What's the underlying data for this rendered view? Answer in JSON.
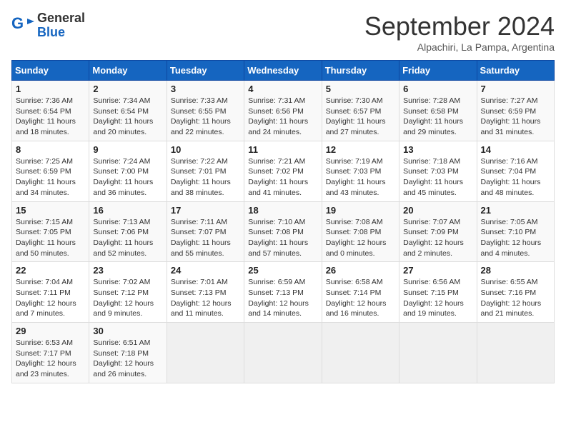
{
  "logo": {
    "line1": "General",
    "line2": "Blue"
  },
  "title": "September 2024",
  "subtitle": "Alpachiri, La Pampa, Argentina",
  "days_of_week": [
    "Sunday",
    "Monday",
    "Tuesday",
    "Wednesday",
    "Thursday",
    "Friday",
    "Saturday"
  ],
  "weeks": [
    [
      {
        "day": "1",
        "sunrise": "Sunrise: 7:36 AM",
        "sunset": "Sunset: 6:54 PM",
        "daylight": "Daylight: 11 hours and 18 minutes."
      },
      {
        "day": "2",
        "sunrise": "Sunrise: 7:34 AM",
        "sunset": "Sunset: 6:54 PM",
        "daylight": "Daylight: 11 hours and 20 minutes."
      },
      {
        "day": "3",
        "sunrise": "Sunrise: 7:33 AM",
        "sunset": "Sunset: 6:55 PM",
        "daylight": "Daylight: 11 hours and 22 minutes."
      },
      {
        "day": "4",
        "sunrise": "Sunrise: 7:31 AM",
        "sunset": "Sunset: 6:56 PM",
        "daylight": "Daylight: 11 hours and 24 minutes."
      },
      {
        "day": "5",
        "sunrise": "Sunrise: 7:30 AM",
        "sunset": "Sunset: 6:57 PM",
        "daylight": "Daylight: 11 hours and 27 minutes."
      },
      {
        "day": "6",
        "sunrise": "Sunrise: 7:28 AM",
        "sunset": "Sunset: 6:58 PM",
        "daylight": "Daylight: 11 hours and 29 minutes."
      },
      {
        "day": "7",
        "sunrise": "Sunrise: 7:27 AM",
        "sunset": "Sunset: 6:59 PM",
        "daylight": "Daylight: 11 hours and 31 minutes."
      }
    ],
    [
      {
        "day": "8",
        "sunrise": "Sunrise: 7:25 AM",
        "sunset": "Sunset: 6:59 PM",
        "daylight": "Daylight: 11 hours and 34 minutes."
      },
      {
        "day": "9",
        "sunrise": "Sunrise: 7:24 AM",
        "sunset": "Sunset: 7:00 PM",
        "daylight": "Daylight: 11 hours and 36 minutes."
      },
      {
        "day": "10",
        "sunrise": "Sunrise: 7:22 AM",
        "sunset": "Sunset: 7:01 PM",
        "daylight": "Daylight: 11 hours and 38 minutes."
      },
      {
        "day": "11",
        "sunrise": "Sunrise: 7:21 AM",
        "sunset": "Sunset: 7:02 PM",
        "daylight": "Daylight: 11 hours and 41 minutes."
      },
      {
        "day": "12",
        "sunrise": "Sunrise: 7:19 AM",
        "sunset": "Sunset: 7:03 PM",
        "daylight": "Daylight: 11 hours and 43 minutes."
      },
      {
        "day": "13",
        "sunrise": "Sunrise: 7:18 AM",
        "sunset": "Sunset: 7:03 PM",
        "daylight": "Daylight: 11 hours and 45 minutes."
      },
      {
        "day": "14",
        "sunrise": "Sunrise: 7:16 AM",
        "sunset": "Sunset: 7:04 PM",
        "daylight": "Daylight: 11 hours and 48 minutes."
      }
    ],
    [
      {
        "day": "15",
        "sunrise": "Sunrise: 7:15 AM",
        "sunset": "Sunset: 7:05 PM",
        "daylight": "Daylight: 11 hours and 50 minutes."
      },
      {
        "day": "16",
        "sunrise": "Sunrise: 7:13 AM",
        "sunset": "Sunset: 7:06 PM",
        "daylight": "Daylight: 11 hours and 52 minutes."
      },
      {
        "day": "17",
        "sunrise": "Sunrise: 7:11 AM",
        "sunset": "Sunset: 7:07 PM",
        "daylight": "Daylight: 11 hours and 55 minutes."
      },
      {
        "day": "18",
        "sunrise": "Sunrise: 7:10 AM",
        "sunset": "Sunset: 7:08 PM",
        "daylight": "Daylight: 11 hours and 57 minutes."
      },
      {
        "day": "19",
        "sunrise": "Sunrise: 7:08 AM",
        "sunset": "Sunset: 7:08 PM",
        "daylight": "Daylight: 12 hours and 0 minutes."
      },
      {
        "day": "20",
        "sunrise": "Sunrise: 7:07 AM",
        "sunset": "Sunset: 7:09 PM",
        "daylight": "Daylight: 12 hours and 2 minutes."
      },
      {
        "day": "21",
        "sunrise": "Sunrise: 7:05 AM",
        "sunset": "Sunset: 7:10 PM",
        "daylight": "Daylight: 12 hours and 4 minutes."
      }
    ],
    [
      {
        "day": "22",
        "sunrise": "Sunrise: 7:04 AM",
        "sunset": "Sunset: 7:11 PM",
        "daylight": "Daylight: 12 hours and 7 minutes."
      },
      {
        "day": "23",
        "sunrise": "Sunrise: 7:02 AM",
        "sunset": "Sunset: 7:12 PM",
        "daylight": "Daylight: 12 hours and 9 minutes."
      },
      {
        "day": "24",
        "sunrise": "Sunrise: 7:01 AM",
        "sunset": "Sunset: 7:13 PM",
        "daylight": "Daylight: 12 hours and 11 minutes."
      },
      {
        "day": "25",
        "sunrise": "Sunrise: 6:59 AM",
        "sunset": "Sunset: 7:13 PM",
        "daylight": "Daylight: 12 hours and 14 minutes."
      },
      {
        "day": "26",
        "sunrise": "Sunrise: 6:58 AM",
        "sunset": "Sunset: 7:14 PM",
        "daylight": "Daylight: 12 hours and 16 minutes."
      },
      {
        "day": "27",
        "sunrise": "Sunrise: 6:56 AM",
        "sunset": "Sunset: 7:15 PM",
        "daylight": "Daylight: 12 hours and 19 minutes."
      },
      {
        "day": "28",
        "sunrise": "Sunrise: 6:55 AM",
        "sunset": "Sunset: 7:16 PM",
        "daylight": "Daylight: 12 hours and 21 minutes."
      }
    ],
    [
      {
        "day": "29",
        "sunrise": "Sunrise: 6:53 AM",
        "sunset": "Sunset: 7:17 PM",
        "daylight": "Daylight: 12 hours and 23 minutes."
      },
      {
        "day": "30",
        "sunrise": "Sunrise: 6:51 AM",
        "sunset": "Sunset: 7:18 PM",
        "daylight": "Daylight: 12 hours and 26 minutes."
      },
      null,
      null,
      null,
      null,
      null
    ]
  ]
}
